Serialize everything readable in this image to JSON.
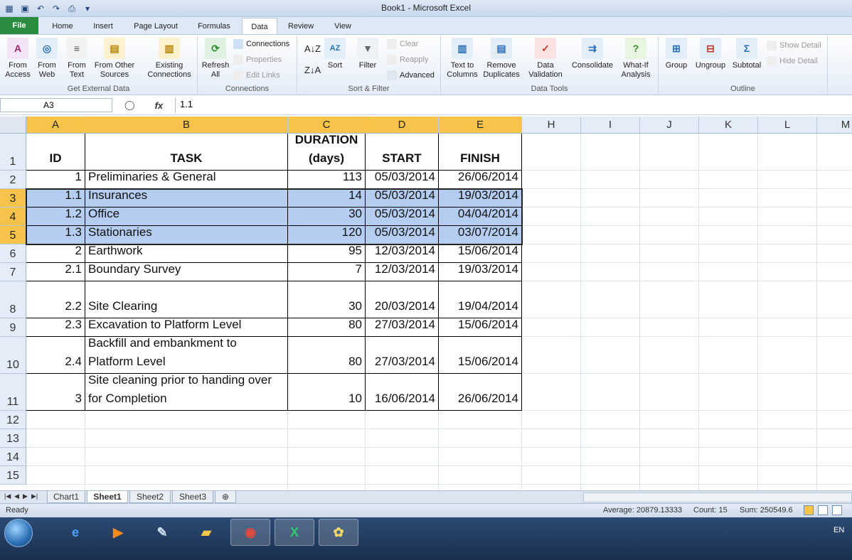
{
  "window": {
    "title": "Book1 - Microsoft Excel"
  },
  "qat": {
    "icons": [
      "save-icon",
      "undo-icon",
      "redo-icon"
    ]
  },
  "tabs": [
    "File",
    "Home",
    "Insert",
    "Page Layout",
    "Formulas",
    "Data",
    "Review",
    "View"
  ],
  "active_tab": "Data",
  "ribbon": {
    "get_external_data": {
      "label": "Get External Data",
      "from_access": "From Access",
      "from_web": "From Web",
      "from_text": "From Text",
      "from_other": "From Other Sources",
      "existing": "Existing Connections"
    },
    "connections": {
      "label": "Connections",
      "refresh": "Refresh All",
      "connections": "Connections",
      "properties": "Properties",
      "edit_links": "Edit Links"
    },
    "sort_filter": {
      "label": "Sort & Filter",
      "sort": "Sort",
      "filter": "Filter",
      "clear": "Clear",
      "reapply": "Reapply",
      "advanced": "Advanced"
    },
    "data_tools": {
      "label": "Data Tools",
      "text_to_columns": "Text to Columns",
      "remove_duplicates": "Remove Duplicates",
      "data_validation": "Data Validation",
      "consolidate": "Consolidate",
      "what_if": "What-If Analysis"
    },
    "outline": {
      "label": "Outline",
      "group": "Group",
      "ungroup": "Ungroup",
      "subtotal": "Subtotal",
      "show_detail": "Show Detail",
      "hide_detail": "Hide Detail"
    }
  },
  "formula_bar": {
    "name_box": "A3",
    "fx": "fx",
    "value": "1.1"
  },
  "columns": [
    "A",
    "B",
    "C",
    "D",
    "E",
    "H",
    "I",
    "J",
    "K",
    "L",
    "M"
  ],
  "row_numbers": [
    "1",
    "2",
    "3",
    "4",
    "5",
    "6",
    "7",
    "8",
    "9",
    "10",
    "11",
    "12",
    "13",
    "14",
    "15"
  ],
  "header": {
    "id": "ID",
    "task": "TASK",
    "duration1": "DURATION",
    "duration2": "(days)",
    "start": "START",
    "finish": "FINISH"
  },
  "rows": [
    {
      "id": "1",
      "task": "Preliminaries & General",
      "duration": "113",
      "start": "05/03/2014",
      "finish": "26/06/2014"
    },
    {
      "id": "1.1",
      "task": "Insurances",
      "duration": "14",
      "start": "05/03/2014",
      "finish": "19/03/2014"
    },
    {
      "id": "1.2",
      "task": "Office",
      "duration": "30",
      "start": "05/03/2014",
      "finish": "04/04/2014"
    },
    {
      "id": "1.3",
      "task": "Stationaries",
      "duration": "120",
      "start": "05/03/2014",
      "finish": "03/07/2014"
    },
    {
      "id": "2",
      "task": "Earthwork",
      "duration": "95",
      "start": "12/03/2014",
      "finish": "15/06/2014"
    },
    {
      "id": "2.1",
      "task": "Boundary Survey",
      "duration": "7",
      "start": "12/03/2014",
      "finish": "19/03/2014"
    },
    {
      "id": "2.2",
      "task": "Site Clearing",
      "duration": "30",
      "start": "20/03/2014",
      "finish": "19/04/2014"
    },
    {
      "id": "2.3",
      "task": "Excavation to Platform Level",
      "duration": "80",
      "start": "27/03/2014",
      "finish": "15/06/2014"
    },
    {
      "id": "2.4",
      "task": "Backfill and embankment to Platform Level",
      "duration": "80",
      "start": "27/03/2014",
      "finish": "15/06/2014"
    },
    {
      "id": "3",
      "task": "Site cleaning prior to handing over for Completion",
      "duration": "10",
      "start": "16/06/2014",
      "finish": "26/06/2014"
    }
  ],
  "sheets": [
    "Chart1",
    "Sheet1",
    "Sheet2",
    "Sheet3"
  ],
  "active_sheet": "Sheet1",
  "status": {
    "ready": "Ready",
    "average": "Average: 20879.13333",
    "count": "Count: 15",
    "sum": "Sum: 250549.6",
    "zoom_icons": [
      "normal-view-icon",
      "page-layout-icon",
      "page-break-icon"
    ]
  },
  "taskbar": {
    "lang": "EN",
    "apps": [
      "ie-icon",
      "media-player-icon",
      "paint-brush-icon",
      "folder-icon",
      "chrome-icon",
      "excel-icon",
      "paint-icon"
    ]
  }
}
